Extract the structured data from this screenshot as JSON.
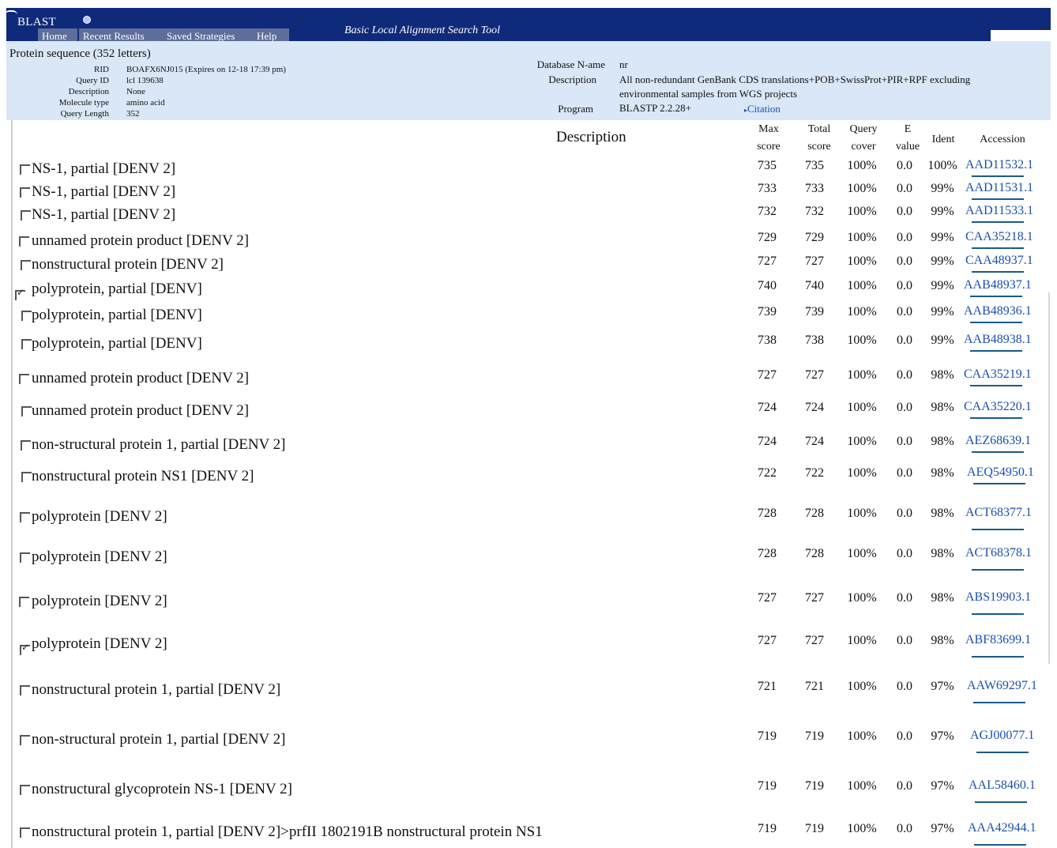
{
  "app": {
    "logo": "BLAST",
    "tagline": "Basic Local Alignment Search Tool",
    "nav": [
      "Home",
      "Recent Results",
      "Saved Strategies",
      "Help"
    ]
  },
  "query": {
    "title": "Protein sequence (352 letters)",
    "fields": [
      {
        "label": "RID",
        "value": "BOAFX6NJ015 (Expires on 12-18 17:39 pm)"
      },
      {
        "label": "Query ID",
        "value": "lcl 139638"
      },
      {
        "label": "Description",
        "value": "None"
      },
      {
        "label": "Molecule type",
        "value": "amino acid"
      },
      {
        "label": "Query Length",
        "value": "352"
      }
    ]
  },
  "database": {
    "name_label": "Database N-ame",
    "name_value": "nr",
    "desc_label": "Description",
    "desc_line1": "All non-redundant GenBank CDS translations+POB+SwissProt+PIR+RPF excluding",
    "desc_line2": "environmental samples from WGS projects",
    "program_label": "Program",
    "program_value": "BLASTP  2.2.28+",
    "citation": "Citation"
  },
  "table": {
    "headers": {
      "description": "Description",
      "max_score_1": "Max",
      "max_score_2": "score",
      "total_score_1": "Total",
      "total_score_2": "score",
      "query_cover_1": "Query",
      "query_cover_2": "cover",
      "e_value_1": "E",
      "e_value_2": "value",
      "ident": "Ident",
      "accession": "Accession"
    },
    "rows": [
      {
        "desc": "NS-1, partial [DENV 2]",
        "max": "735",
        "total": "735",
        "cover": "100%",
        "e": "0.0",
        "ident": "100%",
        "acc": "AAD11532.1",
        "checked": false
      },
      {
        "desc": "NS-1, partial [DENV 2]",
        "max": "733",
        "total": "733",
        "cover": "100%",
        "e": "0.0",
        "ident": "99%",
        "acc": "AAD11531.1",
        "checked": false
      },
      {
        "desc": "NS-1, partial [DENV 2]",
        "max": "732",
        "total": "732",
        "cover": "100%",
        "e": "0.0",
        "ident": "99%",
        "acc": "AAD11533.1",
        "checked": false
      },
      {
        "desc": "unnamed protein product [DENV 2]",
        "max": "729",
        "total": "729",
        "cover": "100%",
        "e": "0.0",
        "ident": "99%",
        "acc": "CAA35218.1",
        "checked": false
      },
      {
        "desc": "nonstructural protein [DENV 2]",
        "max": "727",
        "total": "727",
        "cover": "100%",
        "e": "0.0",
        "ident": "99%",
        "acc": "CAA48937.1",
        "checked": false
      },
      {
        "desc": "polyprotein, partial [DENV]",
        "max": "740",
        "total": "740",
        "cover": "100%",
        "e": "0.0",
        "ident": "99%",
        "acc": "AAB48937.1",
        "checked": true
      },
      {
        "desc": "polyprotein, partial [DENV]",
        "max": "739",
        "total": "739",
        "cover": "100%",
        "e": "0.0",
        "ident": "99%",
        "acc": "AAB48936.1",
        "checked": false
      },
      {
        "desc": "polyprotein, partial [DENV]",
        "max": "738",
        "total": "738",
        "cover": "100%",
        "e": "0.0",
        "ident": "99%",
        "acc": "AAB48938.1",
        "checked": false
      },
      {
        "desc": "unnamed protein product [DENV 2]",
        "max": "727",
        "total": "727",
        "cover": "100%",
        "e": "0.0",
        "ident": "98%",
        "acc": "CAA35219.1",
        "checked": false
      },
      {
        "desc": "unnamed protein product [DENV 2]",
        "max": "724",
        "total": "724",
        "cover": "100%",
        "e": "0.0",
        "ident": "98%",
        "acc": "CAA35220.1",
        "checked": false
      },
      {
        "desc": "non-structural protein 1, partial [DENV 2]",
        "max": "724",
        "total": "724",
        "cover": "100%",
        "e": "0.0",
        "ident": "98%",
        "acc": "AEZ68639.1",
        "checked": false
      },
      {
        "desc": "nonstructural protein NS1 [DENV 2]",
        "max": "722",
        "total": "722",
        "cover": "100%",
        "e": "0.0",
        "ident": "98%",
        "acc": "AEQ54950.1",
        "checked": false
      },
      {
        "desc": "polyprotein [DENV 2]",
        "max": "728",
        "total": "728",
        "cover": "100%",
        "e": "0.0",
        "ident": "98%",
        "acc": "ACT68377.1",
        "checked": false
      },
      {
        "desc": "polyprotein [DENV 2]",
        "max": "728",
        "total": "728",
        "cover": "100%",
        "e": "0.0",
        "ident": "98%",
        "acc": "ACT68378.1",
        "checked": false
      },
      {
        "desc": "polyprotein [DENV 2]",
        "max": "727",
        "total": "727",
        "cover": "100%",
        "e": "0.0",
        "ident": "98%",
        "acc": "ABS19903.1",
        "checked": false
      },
      {
        "desc": "polyprotein [DENV 2]",
        "max": "727",
        "total": "727",
        "cover": "100%",
        "e": "0.0",
        "ident": "98%",
        "acc": "ABF83699.1",
        "checked": true
      },
      {
        "desc": "nonstructural protein 1, partial [DENV 2]",
        "max": "721",
        "total": "721",
        "cover": "100%",
        "e": "0.0",
        "ident": "97%",
        "acc": "AAW69297.1",
        "checked": false
      },
      {
        "desc": "non-structural protein 1, partial [DENV 2]",
        "max": "719",
        "total": "719",
        "cover": "100%",
        "e": "0.0",
        "ident": "97%",
        "acc": "AGJ00077.1",
        "checked": false
      },
      {
        "desc": "nonstructural glycoprotein NS-1 [DENV 2]",
        "max": "719",
        "total": "719",
        "cover": "100%",
        "e": "0.0",
        "ident": "97%",
        "acc": "AAL58460.1",
        "checked": false
      },
      {
        "desc": "nonstructural protein 1, partial [DENV 2]>prfII 1802191B nonstructural protein NS1",
        "max": "719",
        "total": "719",
        "cover": "100%",
        "e": "0.0",
        "ident": "97%",
        "acc": "AAA42944.1",
        "checked": false
      }
    ]
  },
  "colors": {
    "header_bg": "#0f2a7a",
    "summary_bg": "#d9e7f6",
    "link": "#1a4fb0"
  }
}
